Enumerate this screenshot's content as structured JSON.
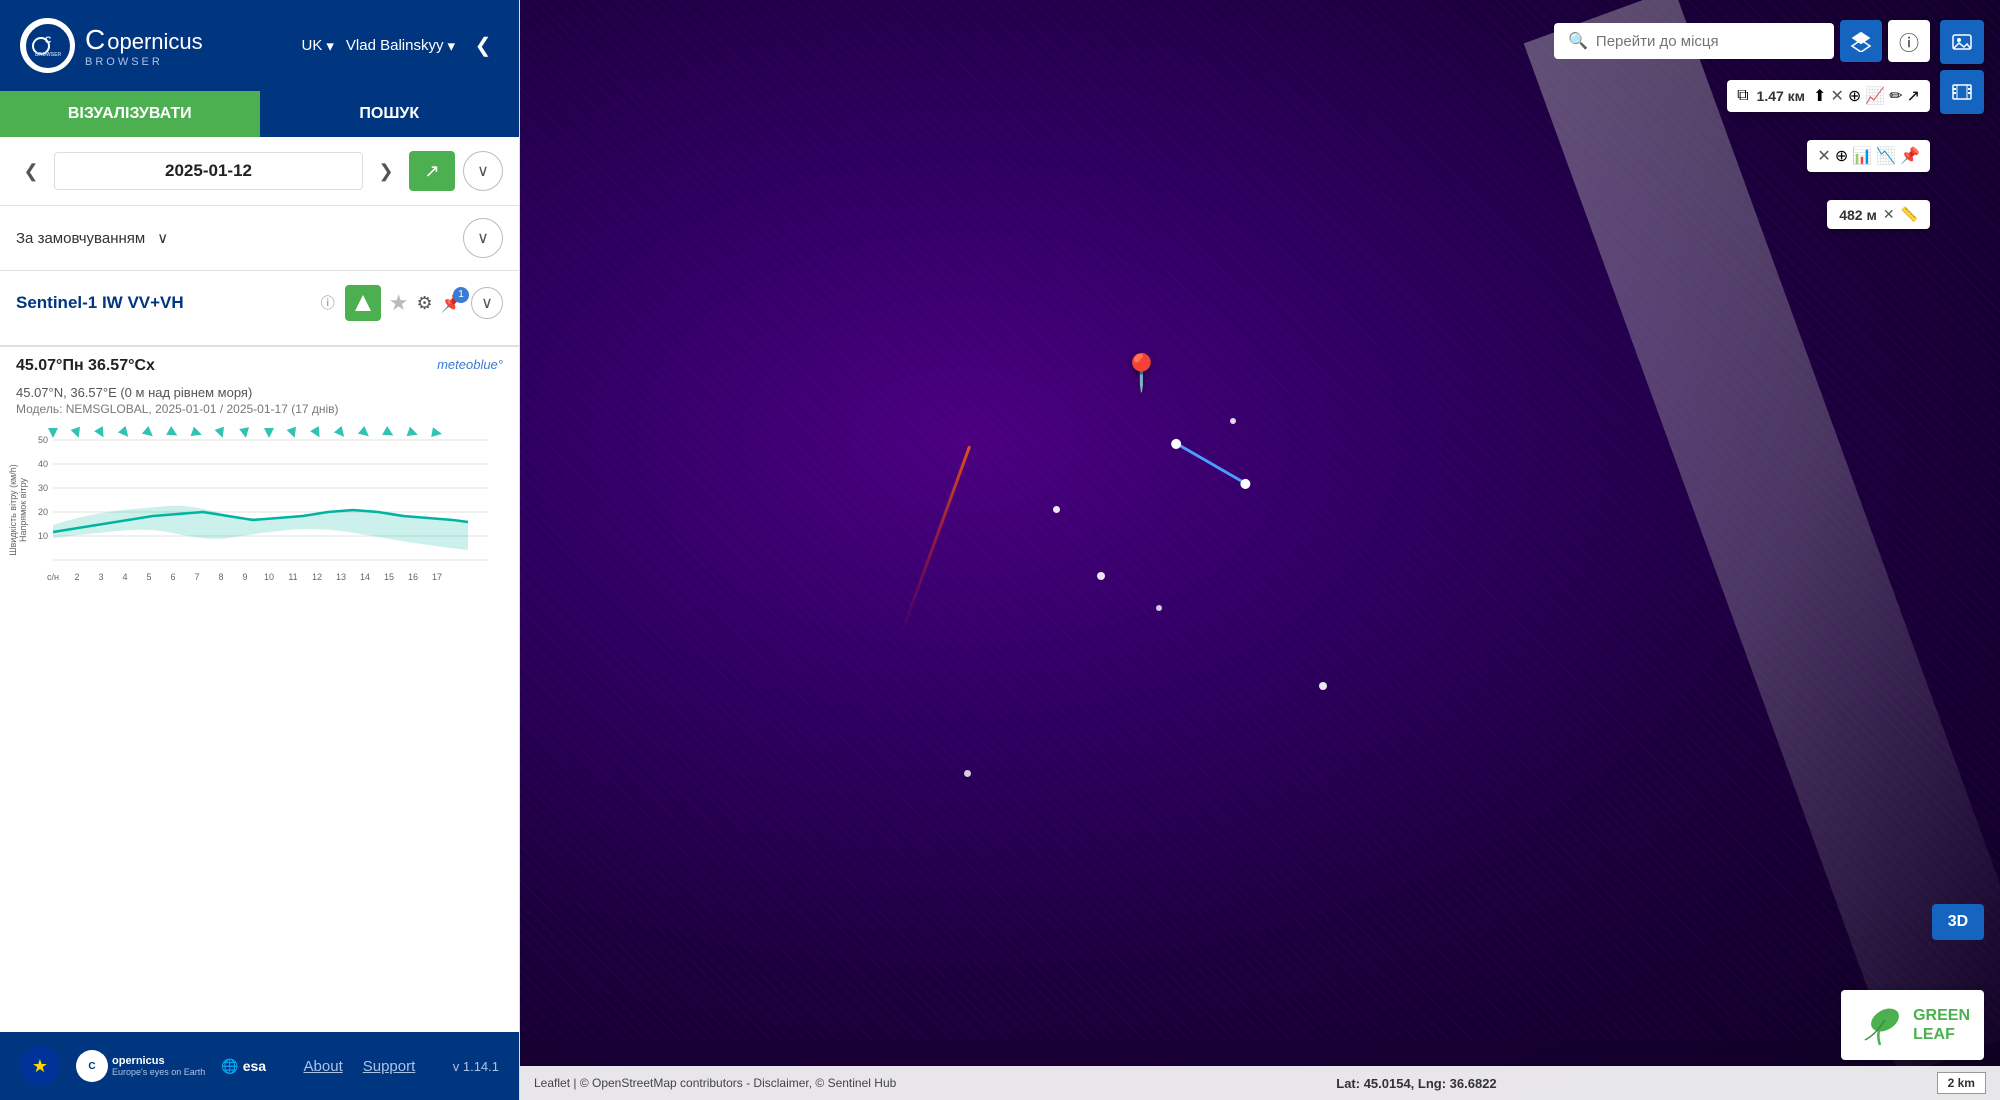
{
  "header": {
    "logo_text": "opernicus",
    "logo_sub": "BROWSER",
    "lang": "UK",
    "user": "Vlad Balinskyy",
    "collapse_icon": "❮"
  },
  "nav": {
    "visualize_label": "ВІЗУАЛІЗУВАТИ",
    "search_label": "ПОШУК"
  },
  "date_bar": {
    "date": "2025-01-12",
    "prev_icon": "❮",
    "next_icon": "❯",
    "share_icon": "↗",
    "expand_icon": "∨"
  },
  "filter": {
    "label": "За замовчуванням",
    "chevron": "∨",
    "expand_icon": "∨"
  },
  "sentinel": {
    "title": "Sentinel-1 IW VV+VH",
    "info_icon": "ⓘ",
    "vis_icon": "◆",
    "star_icon": "★",
    "sliders_icon": "⚙",
    "pin_icon": "📌",
    "pin_badge": "1",
    "expand_icon": "∨"
  },
  "weather": {
    "title": "45.07°Пн 36.57°Сх",
    "brand": "meteoblue°",
    "coords": "45.07°N, 36.57°E (0 м над рівнем моря)",
    "model": "Модель: NEMSGLOBAL, 2025-01-01 / 2025-01-17 (17 днів)"
  },
  "chart": {
    "y_label": "Швидкість вітру (км/h)",
    "y_label2": "Напрямок вітру",
    "x_values": [
      "с/н",
      "2",
      "3",
      "4",
      "5",
      "6",
      "7",
      "8",
      "9",
      "10",
      "11",
      "12",
      "13",
      "14",
      "15",
      "16",
      "17"
    ],
    "y_ticks": [
      "50",
      "40",
      "30",
      "20",
      "10",
      ""
    ]
  },
  "footer": {
    "about_label": "About",
    "support_label": "Support",
    "version": "v 1.14.1"
  },
  "map": {
    "search_placeholder": "Перейти до місця",
    "measure_distance": "1.47 км",
    "measure_small": "482 м",
    "coord_lat_lng": "Lat: 45.0154, Lng: 36.6822",
    "scale": "2 km",
    "attribution": "Leaflet | © OpenStreetMap contributors - Disclaimer, © Sentinel Hub"
  },
  "greenleaf": {
    "text_line1": "GREEN",
    "text_line2": "LEAF"
  },
  "btn_3d": "3D"
}
